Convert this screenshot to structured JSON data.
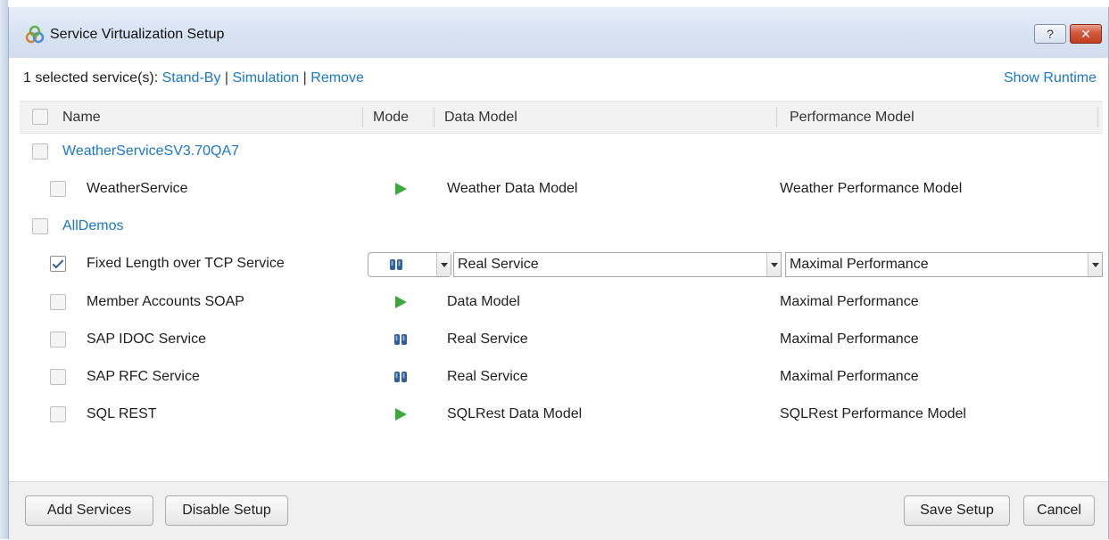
{
  "window": {
    "title": "Service Virtualization Setup",
    "help_label": "?",
    "close_label": "✕"
  },
  "selection_bar": {
    "prefix": "1 selected service(s):",
    "standby": "Stand-By",
    "simulation": "Simulation",
    "remove": "Remove",
    "separator": "|",
    "show_runtime": "Show Runtime"
  },
  "columns": {
    "name": "Name",
    "mode": "Mode",
    "data_model": "Data Model",
    "performance_model": "Performance Model"
  },
  "groups": [
    {
      "name": "WeatherServiceSV3.70QA7",
      "checked": false,
      "services": [
        {
          "name": "WeatherService",
          "checked": false,
          "mode": "play-icon",
          "data_model": "Weather Data Model",
          "performance_model": "Weather Performance Model"
        }
      ]
    },
    {
      "name": "AllDemos",
      "checked": false,
      "services": [
        {
          "name": "Fixed Length over TCP Service",
          "checked": true,
          "mode": "standby-icon",
          "data_model": "Real Service",
          "performance_model": "Maximal Performance",
          "editing": true
        },
        {
          "name": "Member Accounts SOAP",
          "checked": false,
          "mode": "play-icon",
          "data_model": "Data Model",
          "performance_model": "Maximal Performance"
        },
        {
          "name": "SAP IDOC Service",
          "checked": false,
          "mode": "standby-icon",
          "data_model": "Real Service",
          "performance_model": "Maximal Performance"
        },
        {
          "name": "SAP RFC Service",
          "checked": false,
          "mode": "standby-icon",
          "data_model": "Real Service",
          "performance_model": "Maximal Performance"
        },
        {
          "name": "SQL REST",
          "checked": false,
          "mode": "play-icon",
          "data_model": "SQLRest Data Model",
          "performance_model": "SQLRest Performance Model"
        }
      ]
    }
  ],
  "footer": {
    "add_services": "Add Services",
    "disable_setup": "Disable Setup",
    "save_setup": "Save Setup",
    "cancel": "Cancel"
  },
  "colors": {
    "link": "#1a77c9",
    "play_icon": "#3aa83a",
    "standby_icon": "#2e5f9a",
    "close_button": "#c94a2f"
  }
}
